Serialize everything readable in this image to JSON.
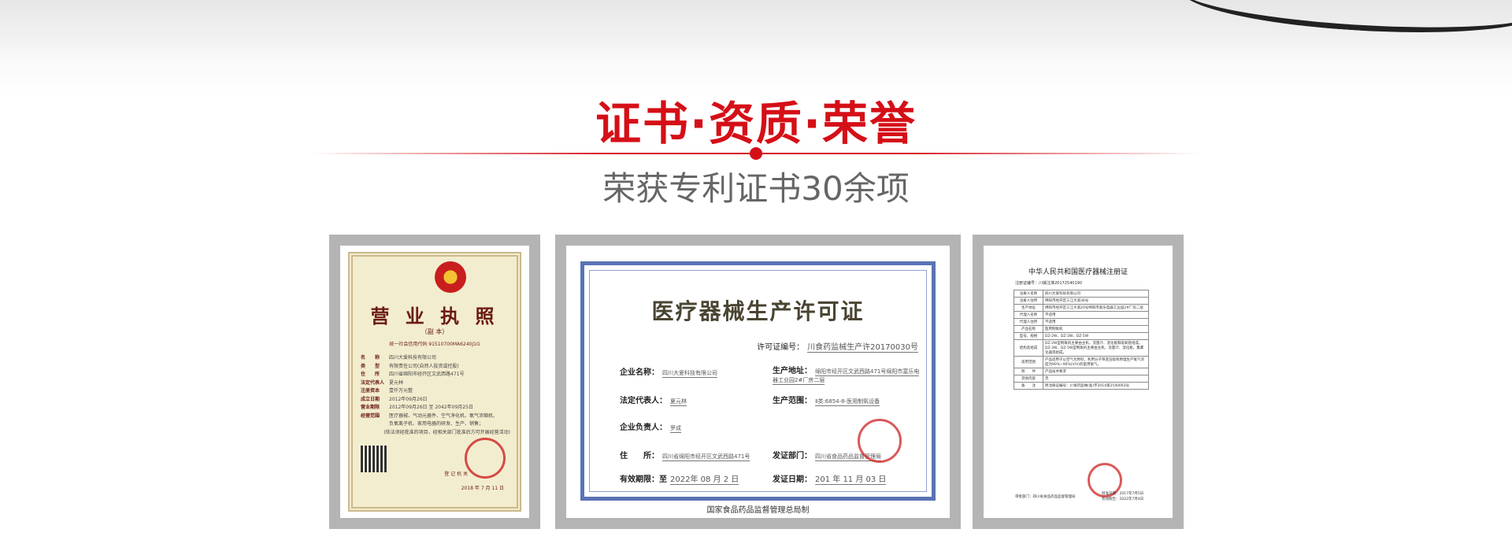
{
  "section": {
    "title": "证书·资质·荣誉",
    "subtitle": "荣获专利证书30余项"
  },
  "colors": {
    "accent": "#d50f17",
    "frame": "#b4b4b4",
    "subtitle": "#666666"
  },
  "certificates": {
    "license": {
      "title": "营 业 执 照",
      "copy": "（副 本）",
      "code": "统一社会信用代码 91510700MA6240J1G",
      "rows": [
        {
          "k": "名　　称",
          "v": "四川大爱科技有限公司"
        },
        {
          "k": "类　　型",
          "v": "有限责任公司(自然人投资或控股)"
        },
        {
          "k": "住　　所",
          "v": "四川省绵阳市经开区文武西路471号"
        },
        {
          "k": "法定代表人",
          "v": "夏元林"
        },
        {
          "k": "注册资本",
          "v": "壹仟万元整"
        },
        {
          "k": "成立日期",
          "v": "2012年09月26日"
        },
        {
          "k": "营业期限",
          "v": "2012年09月26日 至 2042年09月25日"
        },
        {
          "k": "经营范围",
          "v": "医疗器械、气动元器件、空气净化机、氧气浓缩机、"
        },
        {
          "k": "",
          "v": "负氧离子机、家用电器的研发、生产、销售；"
        },
        {
          "k": "",
          "v": "(依法须经批准的项目，经相关部门批准后方可开展经营活动)"
        }
      ],
      "authority": "登 记 机 关",
      "date": "2018 年 7 月 11 日"
    },
    "permit": {
      "title": "医疗器械生产许可证",
      "license_no_label": "许可证编号：",
      "license_no": "川食药监械生产许20170030号",
      "company_label": "企业名称：",
      "company": "四川大爱科技有限公司",
      "address_label": "生产地址：",
      "address": "绵阳市经开区文武西路471号绵阳市富乐电器工业园2#厂房二层",
      "legal_label": "法定代表人：",
      "legal": "夏元林",
      "scope_label": "生产范围：",
      "scope": "Ⅱ类:6854-8-医用制氧设备",
      "manager_label": "企业负责人：",
      "manager": "罗成",
      "residence_label": "住　　所：",
      "residence": "四川省绵阳市经开区文武西路471号",
      "issuer_label": "发证部门：",
      "issuer": "四川省食品药品监督管理局",
      "valid_label": "有效期限：至",
      "valid": "2022年 08 月 2 日",
      "issue_label": "发证日期：",
      "issue": "201 年 11 月 03 日",
      "footer": "国家食品药品监督管理总局制"
    },
    "registration": {
      "title": "中华人民共和国医疗器械注册证",
      "reg_no": "注册证编号：川械注准20172540190",
      "rows": [
        {
          "k": "注册人名称",
          "v": "四川大爱科技有限公司"
        },
        {
          "k": "注册人住所",
          "v": "绵阳市经开区三江大道36号"
        },
        {
          "k": "生产地址",
          "v": "绵阳市经开区三江大道20号绵阳市富乐电器工业园2#厂房二层"
        },
        {
          "k": "代理人名称",
          "v": "不适用"
        },
        {
          "k": "代理人住所",
          "v": "不适用"
        },
        {
          "k": "产品名称",
          "v": "医用制氧机"
        },
        {
          "k": "型号、规格",
          "v": "DZ-2W、DZ-3W、DZ-5W"
        },
        {
          "k": "结构及组成",
          "v": "DZ-2W型制氧机主要由主机、流量计、湿化瓶和吸氧管组成。DZ-3W、DZ-5W型制氧机主要由主机、流量计、湿化瓶、集雾化器等组成。"
        },
        {
          "k": "适用范围",
          "v": "产品适用于以空气为原料，利用分子筛变压吸附原理生产氧气浓度为90%~96%(V/V)的医用氧气。"
        },
        {
          "k": "附　　件",
          "v": "产品技术要求"
        },
        {
          "k": "其他内容",
          "v": "无"
        },
        {
          "k": "备　　注",
          "v": "原注册证编号：川食药监械(准)字2014第2540003号"
        }
      ],
      "foot": "审批部门：四川省食品药品监督管理局",
      "approve_date": "批准日期：2017年7月5日",
      "valid_date": "有效期至：2022年7月4日"
    }
  }
}
